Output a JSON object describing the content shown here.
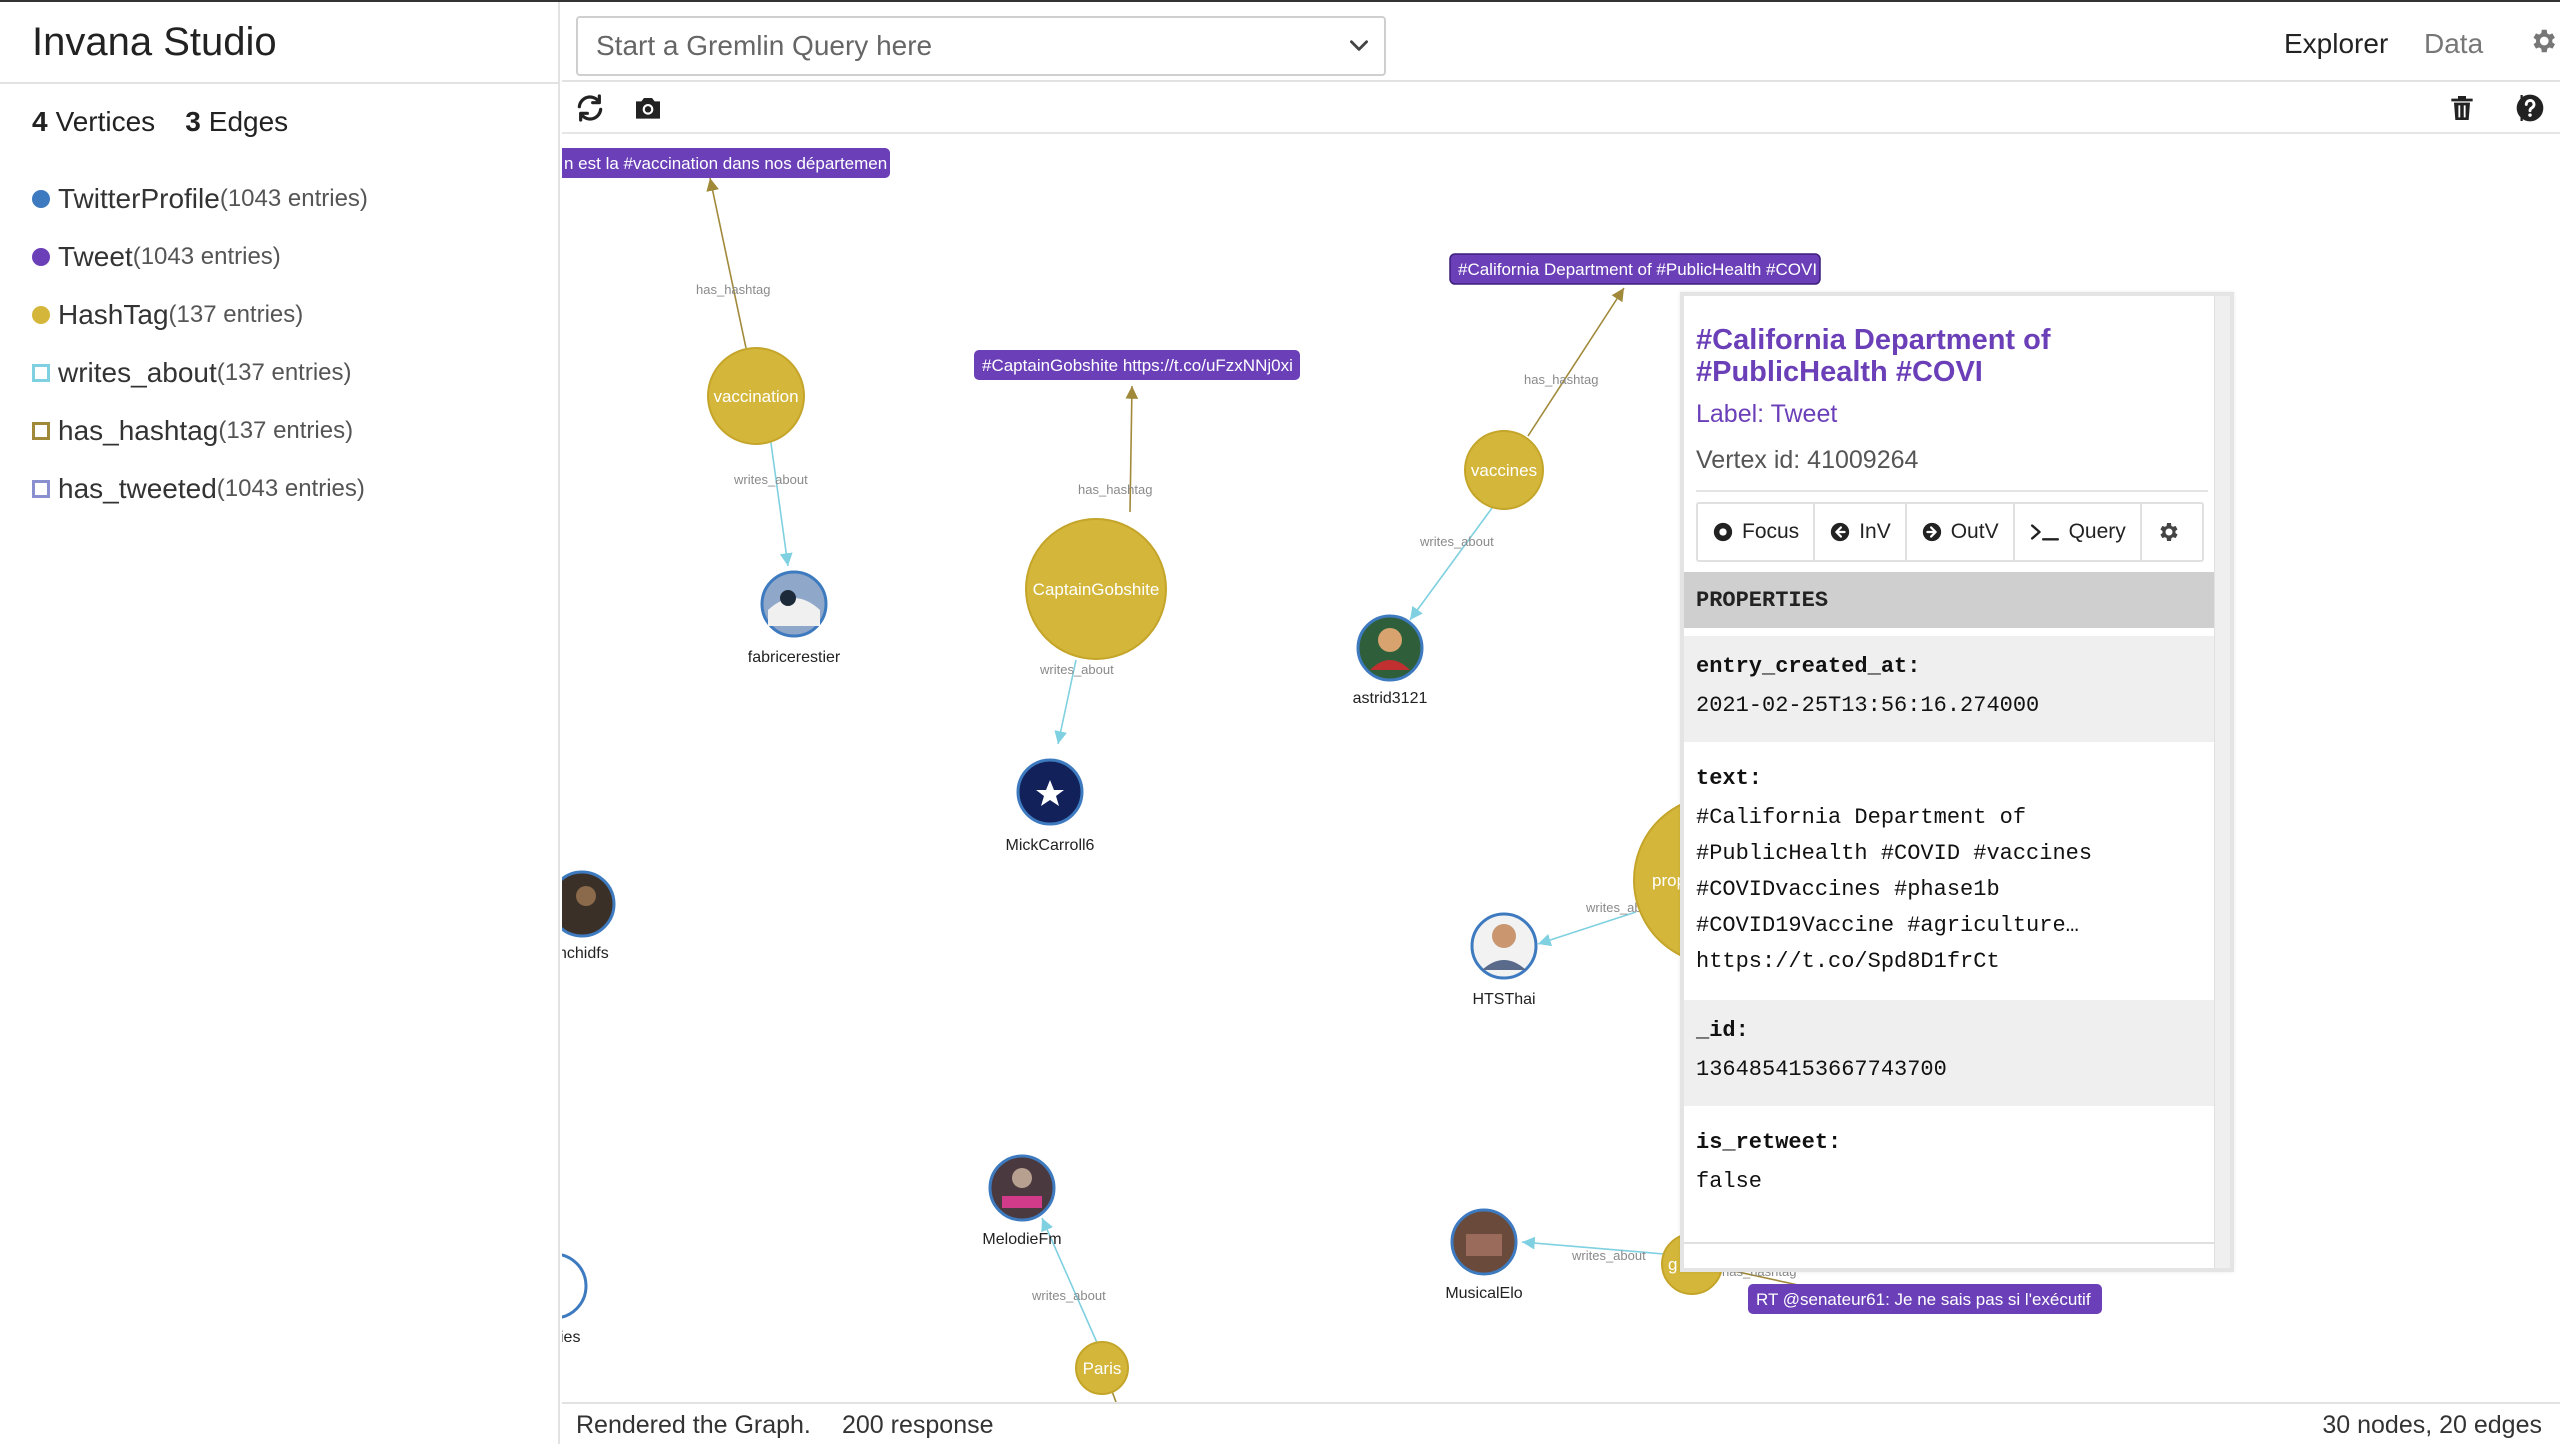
{
  "app": {
    "title": "Invana Studio"
  },
  "header": {
    "query_placeholder": "Start a Gremlin Query here",
    "nav": {
      "explorer": "Explorer",
      "data": "Data"
    }
  },
  "toolbar": {
    "separator": "|"
  },
  "sidebar": {
    "vertices_count": "4",
    "vertices_label": "Vertices",
    "edges_count": "3",
    "edges_label": "Edges",
    "legend": [
      {
        "kind": "vertex",
        "name": "TwitterProfile",
        "count": "(1043 entries)",
        "color": "#3d7abf"
      },
      {
        "kind": "vertex",
        "name": "Tweet",
        "count": "(1043 entries)",
        "color": "#6a3fb8"
      },
      {
        "kind": "vertex",
        "name": "HashTag",
        "count": "(137 entries)",
        "color": "#d4b73a"
      },
      {
        "kind": "edge",
        "name": "writes_about",
        "count": "(137 entries)",
        "color": "#7fd0e0"
      },
      {
        "kind": "edge",
        "name": "has_hashtag",
        "count": "(137 entries)",
        "color": "#a08a3a"
      },
      {
        "kind": "edge",
        "name": "has_tweeted",
        "count": "(1043 entries)",
        "color": "#8a8fd0"
      }
    ]
  },
  "graph": {
    "hashtags": [
      {
        "id": "vaccination",
        "label": "vaccination"
      },
      {
        "id": "captain",
        "label": "CaptainGobshite"
      },
      {
        "id": "vaccines",
        "label": "vaccines"
      },
      {
        "id": "prope",
        "label": "prope"
      },
      {
        "id": "paris",
        "label": "Paris"
      },
      {
        "id": "bottom",
        "label": "g"
      }
    ],
    "profiles": [
      {
        "id": "fabricerestier",
        "label": "fabricerestier"
      },
      {
        "id": "mick",
        "label": "MickCarroll6"
      },
      {
        "id": "astrid",
        "label": "astrid3121"
      },
      {
        "id": "htsthai",
        "label": "HTSThai"
      },
      {
        "id": "melodie",
        "label": "MelodieFm"
      },
      {
        "id": "musical",
        "label": "MusicalElo"
      },
      {
        "id": "nchidfs",
        "label": "nchidfs"
      },
      {
        "id": "ies",
        "label": "ies"
      }
    ],
    "tweets": [
      {
        "id": "t1",
        "label": "n est la #vaccination dans nos départemen"
      },
      {
        "id": "t2",
        "label": "#CaptainGobshite https://t.co/uFzxNNj0xi"
      },
      {
        "id": "t3",
        "label": "#California Department of #PublicHealth #COVI"
      },
      {
        "id": "t4",
        "label": "RT @senateur61: Je ne sais pas si l'exécutif"
      }
    ],
    "edge_labels": {
      "has_hashtag": "has_hashtag",
      "writes_about": "writes_about"
    }
  },
  "detail": {
    "title": "#California Department of #PublicHealth #COVI",
    "label": "Label: Tweet",
    "vertex_id": "Vertex id: 41009264",
    "actions": {
      "focus": "Focus",
      "inv": "InV",
      "outv": "OutV",
      "query": "Query"
    },
    "properties_heading": "PROPERTIES",
    "properties": [
      {
        "key": "entry_created_at:",
        "value": "2021-02-25T13:56:16.274000"
      },
      {
        "key": "text:",
        "value": "#California Department of\n#PublicHealth #COVID #vaccines\n#COVIDvaccines #phase1b\n#COVID19Vaccine #agriculture…\nhttps://t.co/Spd8D1frCt"
      },
      {
        "key": "_id:",
        "value": "1364854153667743700"
      },
      {
        "key": "is_retweet:",
        "value": "false"
      }
    ]
  },
  "footer": {
    "status": "Rendered the Graph.",
    "response": "200 response",
    "summary": "30 nodes, 20 edges"
  }
}
